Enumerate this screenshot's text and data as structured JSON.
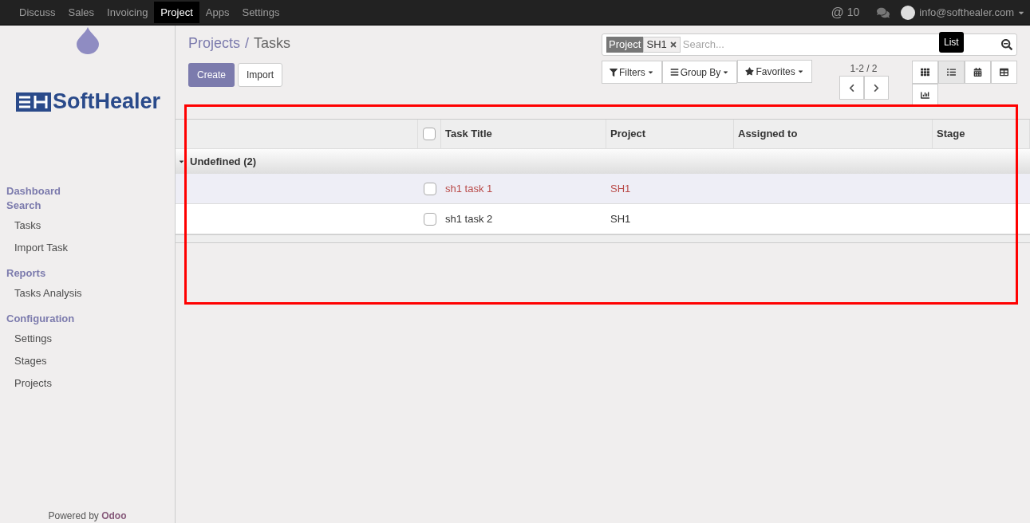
{
  "top_menu": [
    {
      "label": "Discuss",
      "selected": false
    },
    {
      "label": "Sales",
      "selected": false
    },
    {
      "label": "Invoicing",
      "selected": false
    },
    {
      "label": "Project",
      "selected": true
    },
    {
      "label": "Apps",
      "selected": false
    },
    {
      "label": "Settings",
      "selected": false
    }
  ],
  "user_bar": {
    "mention_symbol": "@",
    "mentions": "10",
    "user": "info@softhealer.com"
  },
  "logo": {
    "text": "SoftHealer"
  },
  "sidebar": [
    {
      "kind": "section",
      "label": "Dashboard"
    },
    {
      "kind": "section",
      "label": "Search"
    },
    {
      "kind": "item",
      "label": "Tasks"
    },
    {
      "kind": "item",
      "label": "Import Task"
    },
    {
      "kind": "section",
      "label": "Reports"
    },
    {
      "kind": "item",
      "label": "Tasks Analysis"
    },
    {
      "kind": "section",
      "label": "Configuration"
    },
    {
      "kind": "item",
      "label": "Settings"
    },
    {
      "kind": "item",
      "label": "Stages"
    },
    {
      "kind": "item",
      "label": "Projects"
    }
  ],
  "footer": {
    "text": "Powered by ",
    "brand": "Odoo"
  },
  "breadcrumb_separator": "/",
  "breadcrumb": [
    {
      "label": "Projects",
      "current": false
    },
    {
      "label": "Tasks",
      "current": true
    }
  ],
  "buttons": {
    "create": "Create",
    "import": "Import"
  },
  "search": {
    "facet_label": "Project",
    "facet_value": "SH1",
    "placeholder": "Search..."
  },
  "filters": [
    "Filters",
    "Group By",
    "Favorites"
  ],
  "pager": "1-2 / 2",
  "views": [
    {
      "kind": "kanban",
      "selected": false
    },
    {
      "kind": "list",
      "selected": true
    },
    {
      "kind": "calendar",
      "selected": false
    },
    {
      "kind": "pivot",
      "selected": false
    },
    {
      "kind": "graph",
      "selected": false
    }
  ],
  "tooltip": "List",
  "table": {
    "columns": [
      "Task Title",
      "Project",
      "Assigned to",
      "Stage"
    ],
    "all_checked": false,
    "group": {
      "label": "Undefined (2)",
      "expanded": true
    },
    "rows": [
      {
        "title": "sh1 task 1",
        "project": "SH1",
        "checked": false,
        "hovered": true,
        "overdue": true
      },
      {
        "title": "sh1 task 2",
        "project": "SH1",
        "checked": false,
        "hovered": false,
        "overdue": false
      }
    ]
  }
}
